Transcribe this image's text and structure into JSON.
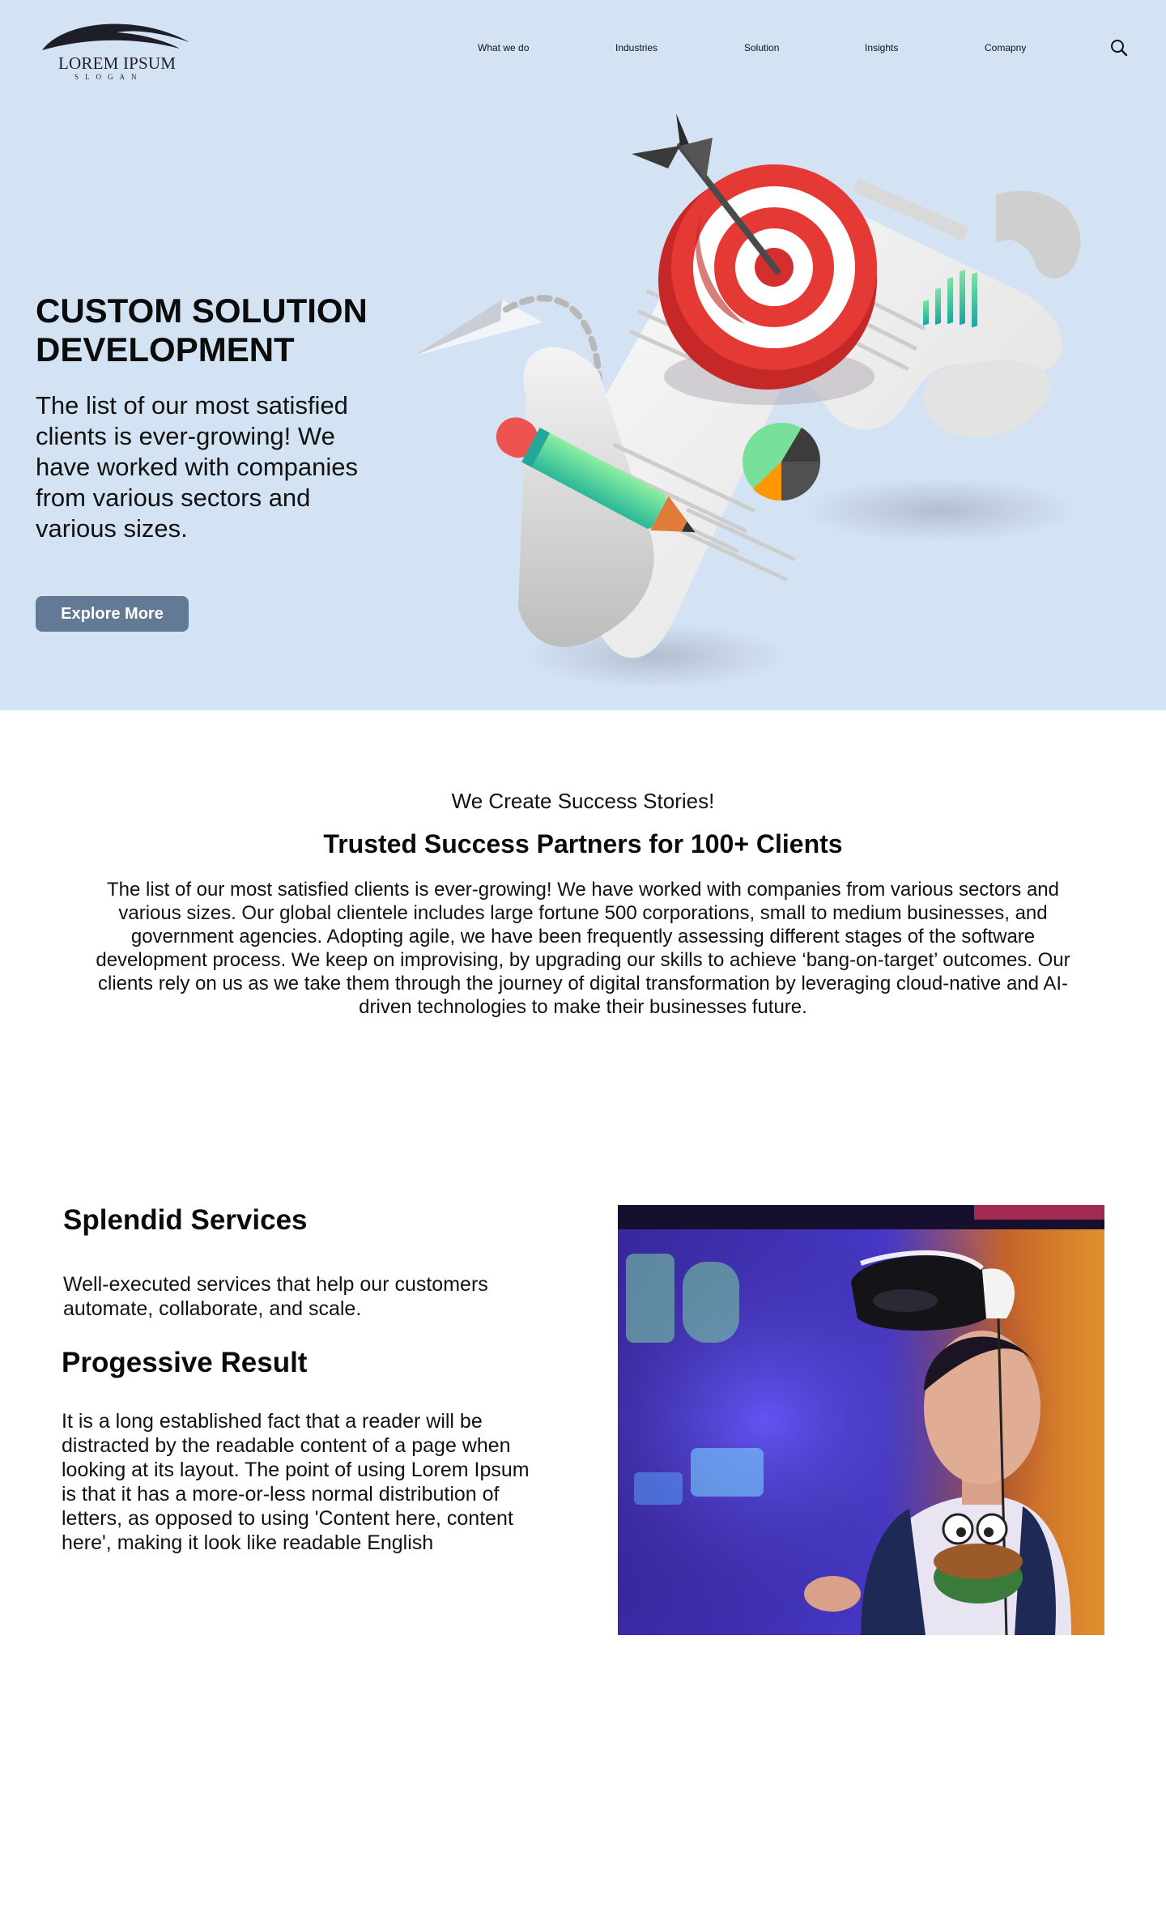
{
  "brand": {
    "name": "LOREM IPSUM",
    "slogan": "SLOGAN"
  },
  "nav": {
    "items": [
      "What we do",
      "Industries",
      "Solution",
      "Insights",
      "Comapny"
    ],
    "search_icon": "search-icon"
  },
  "hero": {
    "title": "CUSTOM SOLUTION DEVELOPMENT",
    "description": "The list of our most satisfied clients is ever-growing! We have worked with companies from various sectors and various sizes.",
    "button_label": "Explore More",
    "background_color": "#d4e3f4",
    "button_color": "#637a94"
  },
  "success": {
    "kicker": "We Create Success Stories!",
    "title": "Trusted Success Partners for 100+ Clients",
    "body": "The list of our most satisfied clients is ever-growing! We have worked with companies from various sectors and various sizes. Our global clientele includes large fortune 500 corporations, small to medium businesses, and government agencies. Adopting agile, we have been frequently assessing different stages of the software development process. We keep on improvising, by upgrading our skills to achieve ‘bang-on-target’ outcomes. Our clients rely on us as we take them through the journey of digital transformation by leveraging cloud-native and AI-driven technologies to make their businesses future."
  },
  "services": {
    "title": "Splendid Services",
    "description": "Well-executed services that help our customers automate, collaborate, and scale.",
    "result_title": "Progessive Result",
    "result_description": "It is a long established fact that a reader will be distracted by the readable content of a page when looking at its layout. The point of using Lorem Ipsum is that it has a more-or-less normal distribution of letters, as opposed to using 'Content here, content here', making it look like readable English"
  }
}
